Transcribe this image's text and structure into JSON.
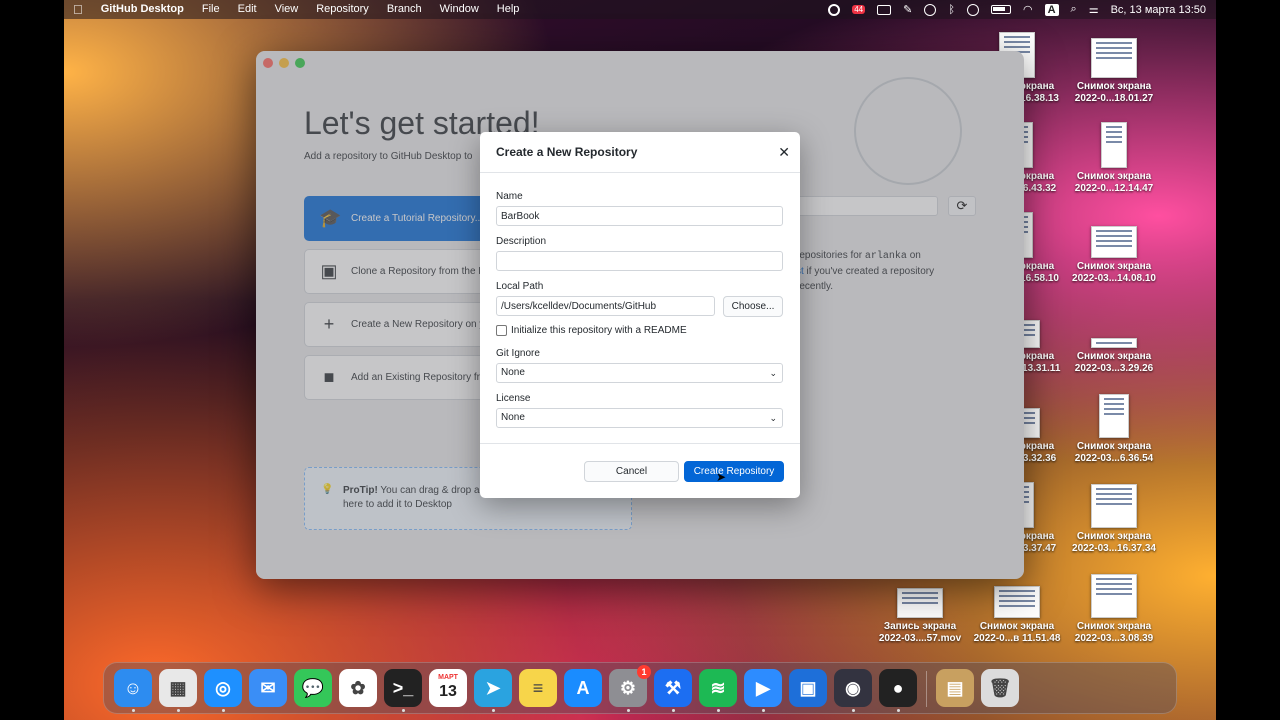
{
  "menubar": {
    "apple": "",
    "app_name": "GitHub Desktop",
    "items": [
      "File",
      "Edit",
      "View",
      "Repository",
      "Branch",
      "Window",
      "Help"
    ],
    "badge_count": "44",
    "datetime": "Вс, 13 марта  13:50"
  },
  "welcome": {
    "title": "Let's get started!",
    "subtitle": "Add a repository to GitHub Desktop to",
    "options": [
      "Create a Tutorial Repository...",
      "Clone a Repository from the In",
      "Create a New Repository on yo",
      "Add an Existing Repository fro"
    ],
    "protip_bold": "ProTip!",
    "protip_text": " You can drag & drop a",
    "protip_text2": "here to add it to Desktop",
    "right_line1_pre": "repositories for ",
    "right_user": "arlanka",
    "right_line1_post": " on",
    "right_line2_link": "st",
    "right_line2_rest": " if you've created a repository",
    "right_line3": "recently."
  },
  "modal": {
    "title": "Create a New Repository",
    "name_label": "Name",
    "name_value": "BarBook",
    "description_label": "Description",
    "description_value": "",
    "local_path_label": "Local Path",
    "local_path_value": "/Users/kcelldev/Documents/GitHub",
    "choose_label": "Choose...",
    "readme_label": "Initialize this repository with a README",
    "readme_checked": false,
    "gitignore_label": "Git Ignore",
    "gitignore_value": "None",
    "license_label": "License",
    "license_value": "None",
    "cancel_label": "Cancel",
    "create_label": "Create Repository"
  },
  "desktop_icons": [
    {
      "line1": "Снимок экрана",
      "line2": "2022-03...16.38.13"
    },
    {
      "line1": "Снимок экрана",
      "line2": "2022-0...18.01.27"
    },
    {
      "line1": "Снимок экрана",
      "line2": "2022-03...6.43.32"
    },
    {
      "line1": "Снимок экрана",
      "line2": "2022-0...12.14.47"
    },
    {
      "line1": "Снимок экрана",
      "line2": "2022-03...16.58.10"
    },
    {
      "line1": "Снимок экрана",
      "line2": "2022-03...14.08.10"
    },
    {
      "line1": "Снимок экрана",
      "line2": "2022-0...в 13.31.11"
    },
    {
      "line1": "Снимок экрана",
      "line2": "2022-03...3.29.26"
    },
    {
      "line1": "Снимок экрана",
      "line2": "2022-03...3.32.36"
    },
    {
      "line1": "Снимок экрана",
      "line2": "2022-03...6.36.54"
    },
    {
      "line1": "Снимок экрана",
      "line2": "2022-0...13.37.47"
    },
    {
      "line1": "Снимок экрана",
      "line2": "2022-03...16.37.34"
    },
    {
      "line1": "Запись экрана",
      "line2": "2022-03....57.mov"
    },
    {
      "line1": "Снимок экрана",
      "line2": "2022-0...в 11.51.48"
    },
    {
      "line1": "Снимок экрана",
      "line2": "2022-03...3.08.39"
    }
  ],
  "dock": {
    "calendar_month": "МАРТ",
    "calendar_day": "13",
    "settings_badge": "1",
    "icons": [
      "finder-icon",
      "launchpad-icon",
      "safari-icon",
      "mail-icon",
      "messages-icon",
      "photos-icon",
      "terminal-icon",
      "calendar-icon",
      "telegram-icon",
      "notes-icon",
      "app-store-icon",
      "system-preferences-icon",
      "xcode-icon",
      "spotify-icon",
      "zoom-icon",
      "keynote-icon",
      "quicktime-icon",
      "github-desktop-icon",
      "archive-utility-icon",
      "trash-icon"
    ]
  },
  "colors": {
    "accent": "#0366d6",
    "modal_bg": "#ffffff"
  }
}
